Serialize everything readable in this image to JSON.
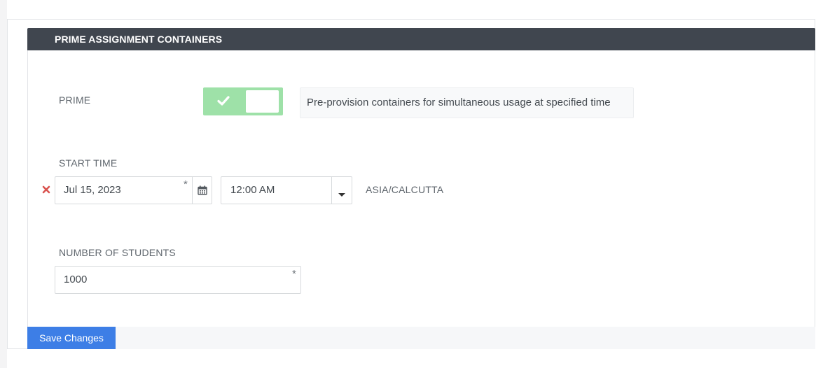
{
  "section": {
    "title": "PRIME ASSIGNMENT CONTAINERS"
  },
  "prime": {
    "label": "PRIME",
    "toggle_on": true,
    "hint": "Pre-provision containers for simultaneous usage at specified time"
  },
  "start_time": {
    "label": "START TIME",
    "date_value": "Jul 15, 2023",
    "time_value": "12:00 AM",
    "timezone": "ASIA/CALCUTTA",
    "required_marker": "*"
  },
  "students": {
    "label": "NUMBER OF STUDENTS",
    "value": "1000",
    "required_marker": "*"
  },
  "footer": {
    "save_label": "Save Changes"
  },
  "icons": {
    "toggle": "check-icon",
    "remove": "close-icon",
    "calendar": "calendar-icon",
    "dropdown": "caret-down-icon"
  },
  "colors": {
    "header_bg": "#40464f",
    "toggle_on": "#9ee1a8",
    "remove_x": "#d9534f",
    "save_button": "#3d7ee6"
  }
}
